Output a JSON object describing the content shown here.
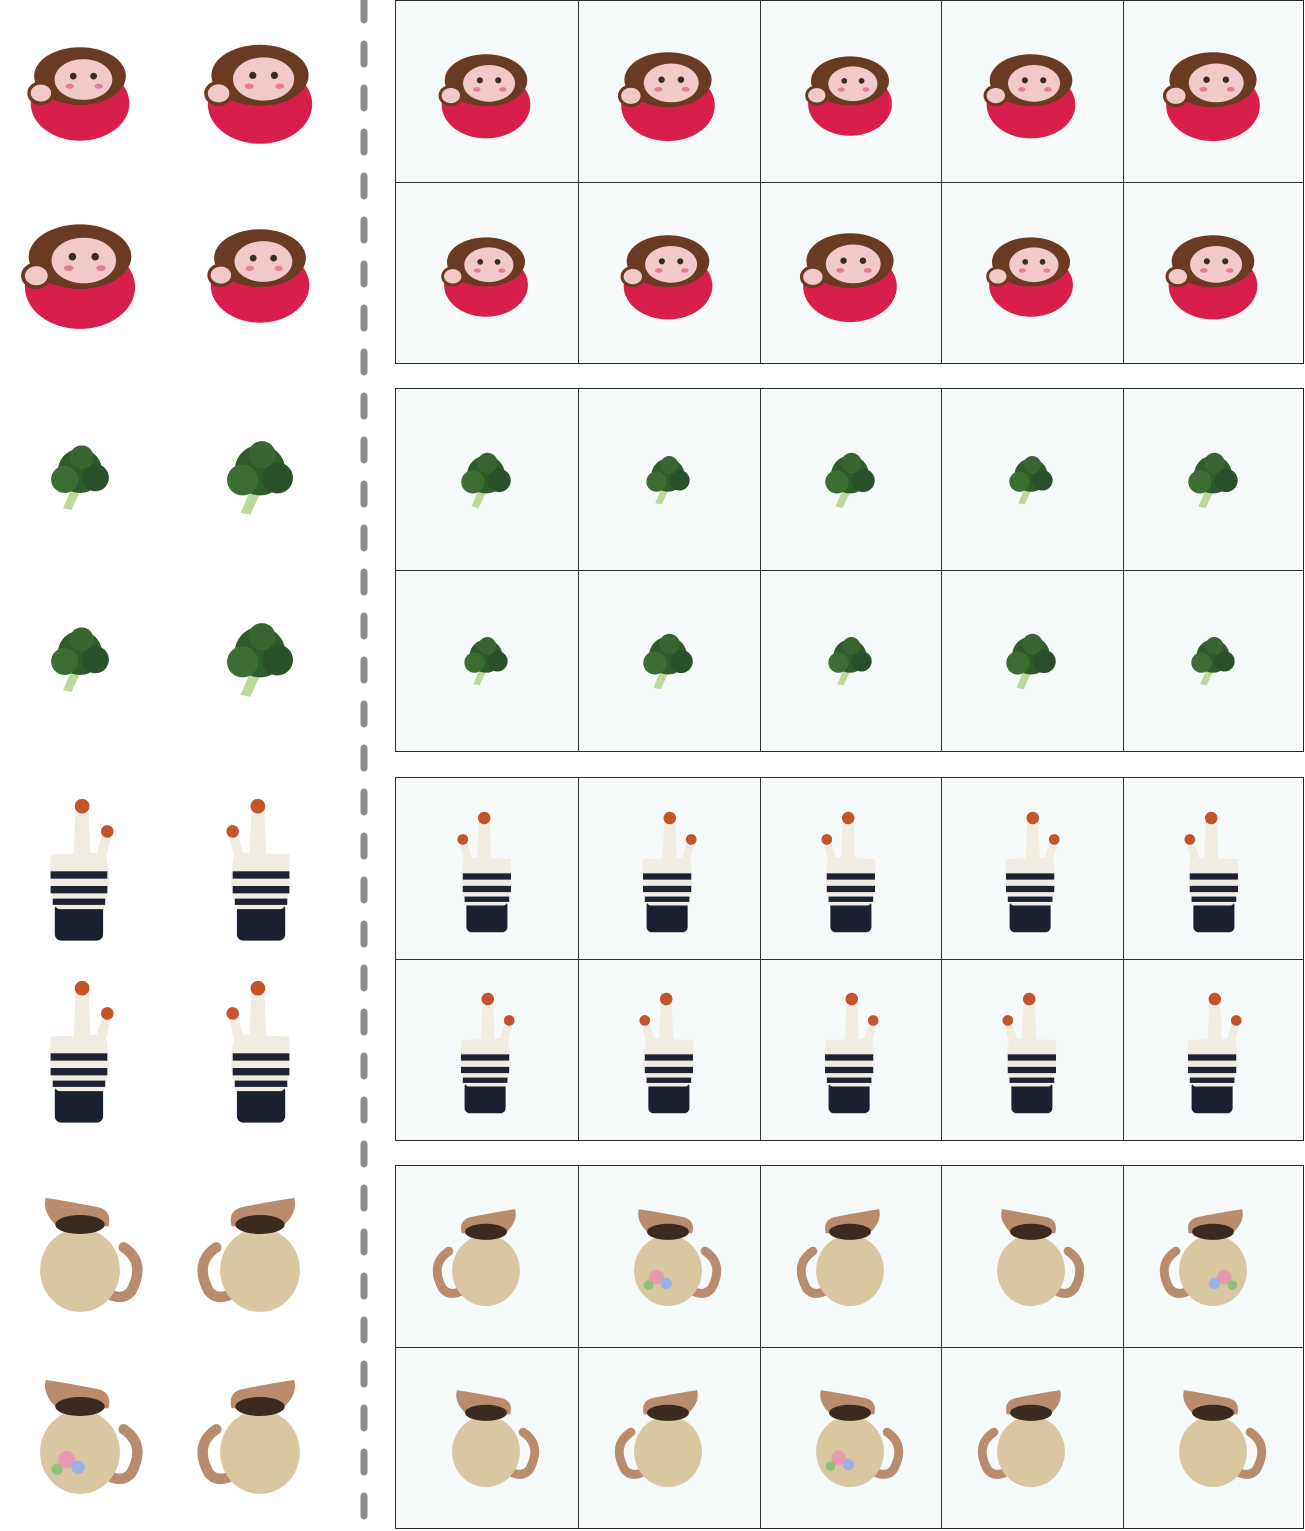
{
  "figure": {
    "objects": [
      "monkey-backpack",
      "broccoli",
      "striped-glove",
      "ceramic-pitcher"
    ],
    "input_views_per_object": 4,
    "generated_views_per_object": 10,
    "colors": {
      "backpack_red": "#d81f4c",
      "backpack_brown": "#6b3a22",
      "monkey_face": "#f2c9c9",
      "broccoli_green": "#2f5a2a",
      "broccoli_stem": "#bcd99a",
      "glove_cream": "#f1ece2",
      "glove_stripe": "#1e2233",
      "glove_cuff": "#1b2030",
      "glove_tip": "#c4542a",
      "pitcher_beige": "#d8c7a1",
      "pitcher_rim": "#b88c6d",
      "divider_gray": "#8c8c8c",
      "grid_bg": "#f7fafb"
    }
  }
}
